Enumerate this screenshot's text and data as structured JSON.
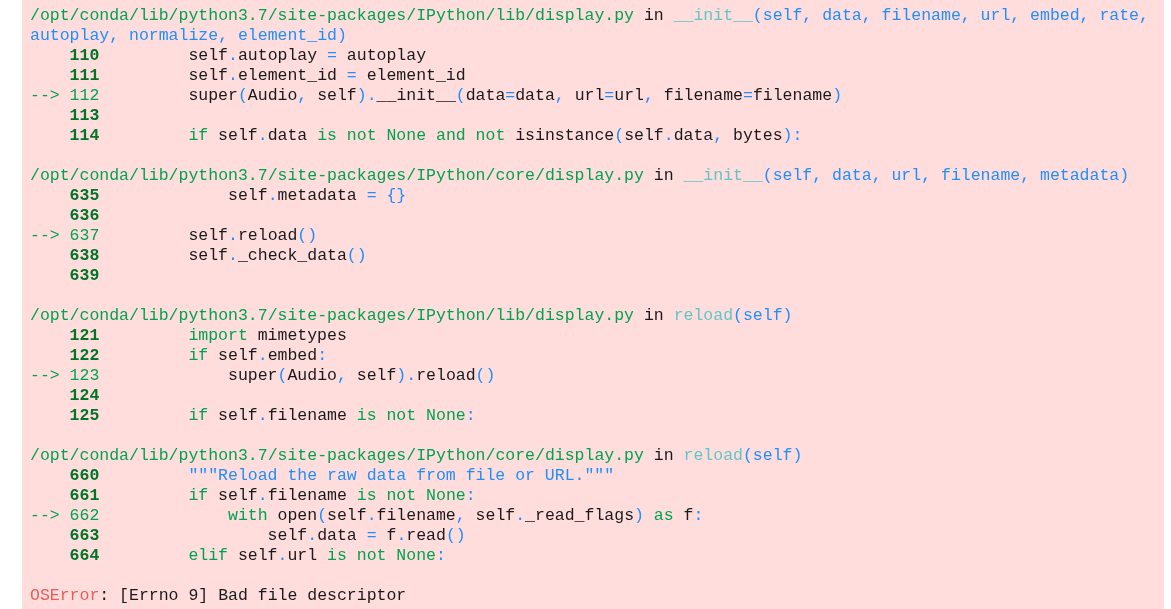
{
  "frames": [
    {
      "file": "/opt/conda/lib/python3.7/site-packages/IPython/lib/display.py",
      "connector": "in",
      "function": "__init__",
      "args": "(self, data, filename, url, embed, rate, autoplay, normalize, element_id)",
      "lines": [
        {
          "number": "110",
          "current": false,
          "code": [
            {
              "kind": "plain",
              "text": "        self"
            },
            {
              "kind": "op",
              "text": "."
            },
            {
              "kind": "plain",
              "text": "autoplay "
            },
            {
              "kind": "op",
              "text": "="
            },
            {
              "kind": "plain",
              "text": " autoplay"
            }
          ]
        },
        {
          "number": "111",
          "current": false,
          "code": [
            {
              "kind": "plain",
              "text": "        self"
            },
            {
              "kind": "op",
              "text": "."
            },
            {
              "kind": "plain",
              "text": "element_id "
            },
            {
              "kind": "op",
              "text": "="
            },
            {
              "kind": "plain",
              "text": " element_id"
            }
          ]
        },
        {
          "number": "112",
          "current": true,
          "arrow": "-->",
          "code": [
            {
              "kind": "plain",
              "text": "        super"
            },
            {
              "kind": "op",
              "text": "("
            },
            {
              "kind": "plain",
              "text": "Audio"
            },
            {
              "kind": "op",
              "text": ","
            },
            {
              "kind": "plain",
              "text": " self"
            },
            {
              "kind": "op",
              "text": ")"
            },
            {
              "kind": "op",
              "text": "."
            },
            {
              "kind": "plain",
              "text": "__init__"
            },
            {
              "kind": "op",
              "text": "("
            },
            {
              "kind": "plain",
              "text": "data"
            },
            {
              "kind": "op",
              "text": "="
            },
            {
              "kind": "plain",
              "text": "data"
            },
            {
              "kind": "op",
              "text": ","
            },
            {
              "kind": "plain",
              "text": " url"
            },
            {
              "kind": "op",
              "text": "="
            },
            {
              "kind": "plain",
              "text": "url"
            },
            {
              "kind": "op",
              "text": ","
            },
            {
              "kind": "plain",
              "text": " filename"
            },
            {
              "kind": "op",
              "text": "="
            },
            {
              "kind": "plain",
              "text": "filename"
            },
            {
              "kind": "op",
              "text": ")"
            }
          ]
        },
        {
          "number": "113",
          "current": false
        },
        {
          "number": "114",
          "current": false,
          "code": [
            {
              "kind": "keyword",
              "text": "        if"
            },
            {
              "kind": "plain",
              "text": " self"
            },
            {
              "kind": "op",
              "text": "."
            },
            {
              "kind": "plain",
              "text": "data "
            },
            {
              "kind": "keyword",
              "text": "is not None and not"
            },
            {
              "kind": "plain",
              "text": " isinstance"
            },
            {
              "kind": "op",
              "text": "("
            },
            {
              "kind": "plain",
              "text": "self"
            },
            {
              "kind": "op",
              "text": "."
            },
            {
              "kind": "plain",
              "text": "data"
            },
            {
              "kind": "op",
              "text": ","
            },
            {
              "kind": "plain",
              "text": " bytes"
            },
            {
              "kind": "op",
              "text": "):"
            }
          ]
        }
      ]
    },
    {
      "file": "/opt/conda/lib/python3.7/site-packages/IPython/core/display.py",
      "connector": "in",
      "function": "__init__",
      "args": "(self, data, url, filename, metadata)",
      "lines": [
        {
          "number": "635",
          "current": false,
          "code": [
            {
              "kind": "plain",
              "text": "            self"
            },
            {
              "kind": "op",
              "text": "."
            },
            {
              "kind": "plain",
              "text": "metadata "
            },
            {
              "kind": "op",
              "text": "= {}"
            }
          ]
        },
        {
          "number": "636",
          "current": false
        },
        {
          "number": "637",
          "current": true,
          "arrow": "-->",
          "code": [
            {
              "kind": "plain",
              "text": "        self"
            },
            {
              "kind": "op",
              "text": "."
            },
            {
              "kind": "plain",
              "text": "reload"
            },
            {
              "kind": "op",
              "text": "()"
            }
          ]
        },
        {
          "number": "638",
          "current": false,
          "code": [
            {
              "kind": "plain",
              "text": "        self"
            },
            {
              "kind": "op",
              "text": "."
            },
            {
              "kind": "plain",
              "text": "_check_data"
            },
            {
              "kind": "op",
              "text": "()"
            }
          ]
        },
        {
          "number": "639",
          "current": false
        }
      ]
    },
    {
      "file": "/opt/conda/lib/python3.7/site-packages/IPython/lib/display.py",
      "connector": "in",
      "function": "reload",
      "args": "(self)",
      "lines": [
        {
          "number": "121",
          "current": false,
          "code": [
            {
              "kind": "keyword",
              "text": "        import"
            },
            {
              "kind": "plain",
              "text": " mimetypes"
            }
          ]
        },
        {
          "number": "122",
          "current": false,
          "code": [
            {
              "kind": "keyword",
              "text": "        if"
            },
            {
              "kind": "plain",
              "text": " self"
            },
            {
              "kind": "op",
              "text": "."
            },
            {
              "kind": "plain",
              "text": "embed"
            },
            {
              "kind": "op",
              "text": ":"
            }
          ]
        },
        {
          "number": "123",
          "current": true,
          "arrow": "-->",
          "code": [
            {
              "kind": "plain",
              "text": "            super"
            },
            {
              "kind": "op",
              "text": "("
            },
            {
              "kind": "plain",
              "text": "Audio"
            },
            {
              "kind": "op",
              "text": ","
            },
            {
              "kind": "plain",
              "text": " self"
            },
            {
              "kind": "op",
              "text": ")"
            },
            {
              "kind": "op",
              "text": "."
            },
            {
              "kind": "plain",
              "text": "reload"
            },
            {
              "kind": "op",
              "text": "()"
            }
          ]
        },
        {
          "number": "124",
          "current": false
        },
        {
          "number": "125",
          "current": false,
          "code": [
            {
              "kind": "keyword",
              "text": "        if"
            },
            {
              "kind": "plain",
              "text": " self"
            },
            {
              "kind": "op",
              "text": "."
            },
            {
              "kind": "plain",
              "text": "filename "
            },
            {
              "kind": "keyword",
              "text": "is not None"
            },
            {
              "kind": "op",
              "text": ":"
            }
          ]
        }
      ]
    },
    {
      "file": "/opt/conda/lib/python3.7/site-packages/IPython/core/display.py",
      "connector": "in",
      "function": "reload",
      "args": "(self)",
      "lines": [
        {
          "number": "660",
          "current": false,
          "code": [
            {
              "kind": "string",
              "text": "        \"\"\"Reload the raw data from file or URL.\"\"\""
            }
          ]
        },
        {
          "number": "661",
          "current": false,
          "code": [
            {
              "kind": "keyword",
              "text": "        if"
            },
            {
              "kind": "plain",
              "text": " self"
            },
            {
              "kind": "op",
              "text": "."
            },
            {
              "kind": "plain",
              "text": "filename "
            },
            {
              "kind": "keyword",
              "text": "is not None"
            },
            {
              "kind": "op",
              "text": ":"
            }
          ]
        },
        {
          "number": "662",
          "current": true,
          "arrow": "-->",
          "code": [
            {
              "kind": "keyword",
              "text": "            with"
            },
            {
              "kind": "plain",
              "text": " open"
            },
            {
              "kind": "op",
              "text": "("
            },
            {
              "kind": "plain",
              "text": "self"
            },
            {
              "kind": "op",
              "text": "."
            },
            {
              "kind": "plain",
              "text": "filename"
            },
            {
              "kind": "op",
              "text": ","
            },
            {
              "kind": "plain",
              "text": " self"
            },
            {
              "kind": "op",
              "text": "."
            },
            {
              "kind": "plain",
              "text": "_read_flags"
            },
            {
              "kind": "op",
              "text": ")"
            },
            {
              "kind": "keyword",
              "text": " as"
            },
            {
              "kind": "plain",
              "text": " f"
            },
            {
              "kind": "op",
              "text": ":"
            }
          ]
        },
        {
          "number": "663",
          "current": false,
          "code": [
            {
              "kind": "plain",
              "text": "                self"
            },
            {
              "kind": "op",
              "text": "."
            },
            {
              "kind": "plain",
              "text": "data "
            },
            {
              "kind": "op",
              "text": "="
            },
            {
              "kind": "plain",
              "text": " f"
            },
            {
              "kind": "op",
              "text": "."
            },
            {
              "kind": "plain",
              "text": "read"
            },
            {
              "kind": "op",
              "text": "()"
            }
          ]
        },
        {
          "number": "664",
          "current": false,
          "code": [
            {
              "kind": "keyword",
              "text": "        elif"
            },
            {
              "kind": "plain",
              "text": " self"
            },
            {
              "kind": "op",
              "text": "."
            },
            {
              "kind": "plain",
              "text": "url "
            },
            {
              "kind": "keyword",
              "text": "is not None"
            },
            {
              "kind": "op",
              "text": ":"
            }
          ]
        }
      ]
    }
  ],
  "error": {
    "type": "OSError",
    "message": ": [Errno 9] Bad file descriptor"
  }
}
